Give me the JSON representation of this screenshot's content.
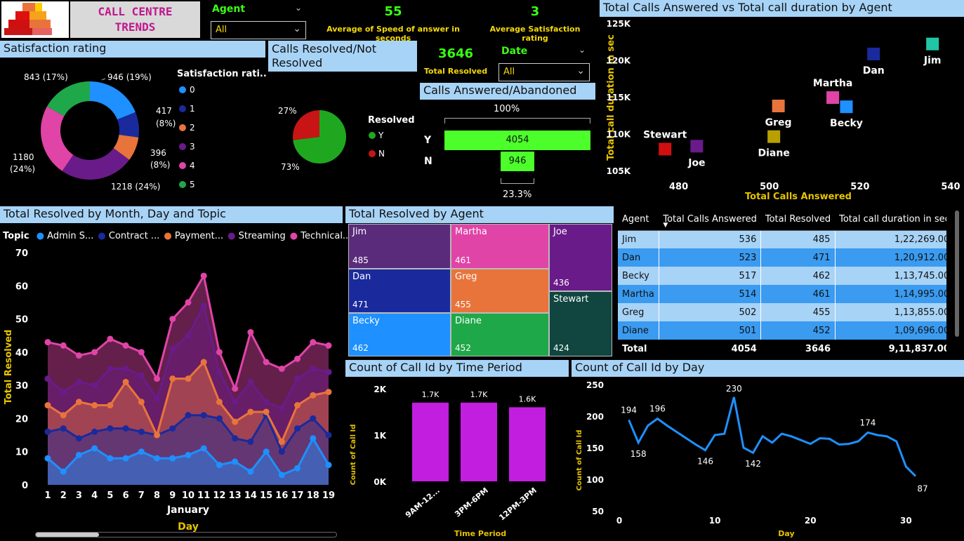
{
  "header": {
    "title_line1": "CALL CENTRE",
    "title_line2": "TRENDS"
  },
  "agent_slicer": {
    "label": "Agent",
    "value": "All"
  },
  "date_slicer": {
    "label": "Date",
    "value": "All"
  },
  "kpis": {
    "speed_value": "55",
    "speed_label": "Average of Speed of answer in seconds",
    "satisfaction_value": "3",
    "satisfaction_label": "Average Satisfaction rating",
    "resolved_value": "3646",
    "resolved_label": "Total Resolved"
  },
  "satisfaction": {
    "title": "Satisfaction rating",
    "legend_title": "Satisfaction rati...",
    "legend": [
      "0",
      "1",
      "2",
      "3",
      "4",
      "5"
    ],
    "labels": [
      "946 (19%)",
      "417",
      "(8%)",
      "396",
      "(8%)",
      "1218 (24%)",
      "1180",
      "(24%)",
      "843 (17%)"
    ]
  },
  "resolved_pie": {
    "title": "Calls Resolved/Not Resolved",
    "legend_title": "Resolved",
    "legend": [
      "Y",
      "N"
    ],
    "pct_y": "73%",
    "pct_n": "27%"
  },
  "funnel": {
    "title": "Calls Answered/Abandoned",
    "top_pct": "100%",
    "bottom_pct": "23.3%",
    "rows": [
      {
        "label": "Y",
        "value": "4054"
      },
      {
        "label": "N",
        "value": "946"
      }
    ]
  },
  "scatter": {
    "title": "Total Calls Answered vs Total call duration by Agent",
    "xlabel": "Total Calls Answered",
    "ylabel": "Total call duration in sec",
    "xticks": [
      "480",
      "500",
      "520",
      "540"
    ],
    "yticks": [
      "125K",
      "120K",
      "115K",
      "110K",
      "105K"
    ]
  },
  "area": {
    "title": "Total Resolved by Month, Day and Topic",
    "legend_title": "Topic",
    "legend": [
      "Admin S...",
      "Contract ...",
      "Payment...",
      "Streaming",
      "Technical..."
    ],
    "ylabel": "Total Resolved",
    "xlabel": "Day",
    "month": "January",
    "yticks": [
      "70",
      "60",
      "50",
      "40",
      "30",
      "20",
      "10",
      "0"
    ]
  },
  "treemap": {
    "title": "Total Resolved by Agent",
    "cells": [
      {
        "name": "Jim",
        "value": "485"
      },
      {
        "name": "Martha",
        "value": "461"
      },
      {
        "name": "Joe",
        "value": "436"
      },
      {
        "name": "Dan",
        "value": "471"
      },
      {
        "name": "Greg",
        "value": "455"
      },
      {
        "name": "Stewart",
        "value": "424"
      },
      {
        "name": "Becky",
        "value": "462"
      },
      {
        "name": "Diane",
        "value": "452"
      }
    ]
  },
  "table": {
    "headers": [
      "Agent",
      "Total Calls Answered",
      "Total Resolved",
      "Total call duration in sec"
    ],
    "rows": [
      [
        "Jim",
        "536",
        "485",
        "1,22,269.00"
      ],
      [
        "Dan",
        "523",
        "471",
        "1,20,912.00"
      ],
      [
        "Becky",
        "517",
        "462",
        "1,13,745.00"
      ],
      [
        "Martha",
        "514",
        "461",
        "1,14,995.00"
      ],
      [
        "Greg",
        "502",
        "455",
        "1,13,855.00"
      ],
      [
        "Diane",
        "501",
        "452",
        "1,09,696.00"
      ]
    ],
    "total": [
      "Total",
      "4054",
      "3646",
      "9,11,837.00"
    ]
  },
  "time_bar": {
    "title": "Count of Call Id by Time Period",
    "ylabel": "Count of Call Id",
    "xlabel": "Time Period",
    "yticks": [
      "2K",
      "1K",
      "0K"
    ]
  },
  "day_line": {
    "title": "Count of Call Id by Day",
    "ylabel": "Count of Call Id",
    "xlabel": "Day",
    "yticks": [
      "250",
      "200",
      "150",
      "100",
      "50"
    ],
    "xticks": [
      "0",
      "10",
      "20",
      "30"
    ]
  },
  "colors": {
    "accent": "#a7d3f7",
    "kpi": "#39ff14",
    "label": "#f5d90a"
  },
  "chart_data": [
    {
      "type": "pie",
      "title": "Satisfaction rating",
      "categories": [
        "0",
        "1",
        "2",
        "3",
        "4",
        "5"
      ],
      "values": [
        946,
        417,
        396,
        1218,
        1180,
        843
      ],
      "colors": [
        "#1e90ff",
        "#1a2a9c",
        "#e8743b",
        "#6a1b8a",
        "#e044a7",
        "#1fa849"
      ]
    },
    {
      "type": "pie",
      "title": "Calls Resolved/Not Resolved",
      "categories": [
        "Y",
        "N"
      ],
      "values": [
        73,
        27
      ],
      "colors": [
        "#1fa81f",
        "#c81414"
      ]
    },
    {
      "type": "bar",
      "title": "Calls Answered/Abandoned",
      "categories": [
        "Y",
        "N"
      ],
      "values": [
        4054,
        946
      ]
    },
    {
      "type": "scatter",
      "title": "Total Calls Answered vs Total call duration by Agent",
      "xlabel": "Total Calls Answered",
      "ylabel": "Total call duration in sec",
      "xlim": [
        470,
        540
      ],
      "ylim": [
        105000,
        125000
      ],
      "points": [
        {
          "name": "Jim",
          "x": 536,
          "y": 122269,
          "color": "#20c7a5"
        },
        {
          "name": "Dan",
          "x": 523,
          "y": 120912,
          "color": "#1a2a9c"
        },
        {
          "name": "Martha",
          "x": 514,
          "y": 114995,
          "color": "#e044a7"
        },
        {
          "name": "Becky",
          "x": 517,
          "y": 113745,
          "color": "#1e90ff"
        },
        {
          "name": "Greg",
          "x": 502,
          "y": 113855,
          "color": "#e8743b"
        },
        {
          "name": "Diane",
          "x": 501,
          "y": 109696,
          "color": "#b8a000"
        },
        {
          "name": "Stewart",
          "x": 477,
          "y": 108000,
          "color": "#d01010"
        },
        {
          "name": "Joe",
          "x": 484,
          "y": 108400,
          "color": "#6a1b8a"
        }
      ]
    },
    {
      "type": "area",
      "title": "Total Resolved by Month, Day and Topic",
      "xlabel": "Day",
      "ylabel": "Total Resolved",
      "ylim": [
        0,
        70
      ],
      "x": [
        1,
        2,
        3,
        4,
        5,
        6,
        7,
        8,
        9,
        10,
        11,
        12,
        13,
        14,
        15,
        16,
        17,
        18,
        19
      ],
      "series": [
        {
          "name": "Admin S...",
          "color": "#1e90ff",
          "values": [
            8,
            4,
            9,
            11,
            8,
            8,
            10,
            8,
            8,
            9,
            11,
            6,
            7,
            4,
            10,
            3,
            5,
            14,
            6
          ]
        },
        {
          "name": "Contract ...",
          "color": "#1a2a9c",
          "values": [
            16,
            17,
            14,
            16,
            17,
            17,
            16,
            15,
            17,
            21,
            21,
            20,
            14,
            13,
            21,
            10,
            17,
            20,
            15
          ]
        },
        {
          "name": "Payment...",
          "color": "#e8743b",
          "values": [
            24,
            21,
            25,
            24,
            24,
            31,
            25,
            15,
            32,
            32,
            37,
            25,
            19,
            22,
            22,
            13,
            24,
            27,
            28
          ]
        },
        {
          "name": "Streaming",
          "color": "#6a1b8a",
          "values": [
            32,
            28,
            31,
            30,
            35,
            35,
            33,
            26,
            41,
            45,
            54,
            34,
            25,
            31,
            25,
            23,
            32,
            35,
            34
          ]
        },
        {
          "name": "Technical...",
          "color": "#e044a7",
          "values": [
            43,
            42,
            39,
            40,
            44,
            42,
            40,
            32,
            50,
            55,
            63,
            40,
            29,
            46,
            37,
            35,
            38,
            43,
            42
          ]
        }
      ]
    },
    {
      "type": "bar",
      "title": "Count of Call Id by Time Period",
      "xlabel": "Time Period",
      "ylabel": "Count of Call Id",
      "ylim": [
        0,
        2000
      ],
      "categories": [
        "9AM-12...",
        "3PM-6PM",
        "12PM-3PM"
      ],
      "values": [
        1700,
        1700,
        1600
      ],
      "data_labels": [
        "1.7K",
        "1.7K",
        "1.6K"
      ]
    },
    {
      "type": "line",
      "title": "Count of Call Id by Day",
      "xlabel": "Day",
      "ylabel": "Count of Call Id",
      "ylim": [
        50,
        250
      ],
      "xlim": [
        0,
        31
      ],
      "x": [
        1,
        2,
        3,
        4,
        5,
        6,
        7,
        8,
        9,
        10,
        11,
        12,
        13,
        14,
        15,
        16,
        17,
        18,
        19,
        20,
        21,
        22,
        23,
        24,
        25,
        26,
        27,
        28,
        29,
        30,
        31
      ],
      "values": [
        194,
        158,
        185,
        196,
        185,
        175,
        165,
        155,
        146,
        170,
        172,
        230,
        150,
        142,
        168,
        158,
        172,
        168,
        162,
        156,
        165,
        164,
        155,
        156,
        160,
        174,
        170,
        168,
        160,
        120,
        105
      ],
      "data_labels": {
        "1": "194",
        "2": "158",
        "4": "196",
        "9": "146",
        "12": "230",
        "14": "142",
        "26": "174",
        "31": "87"
      }
    }
  ]
}
